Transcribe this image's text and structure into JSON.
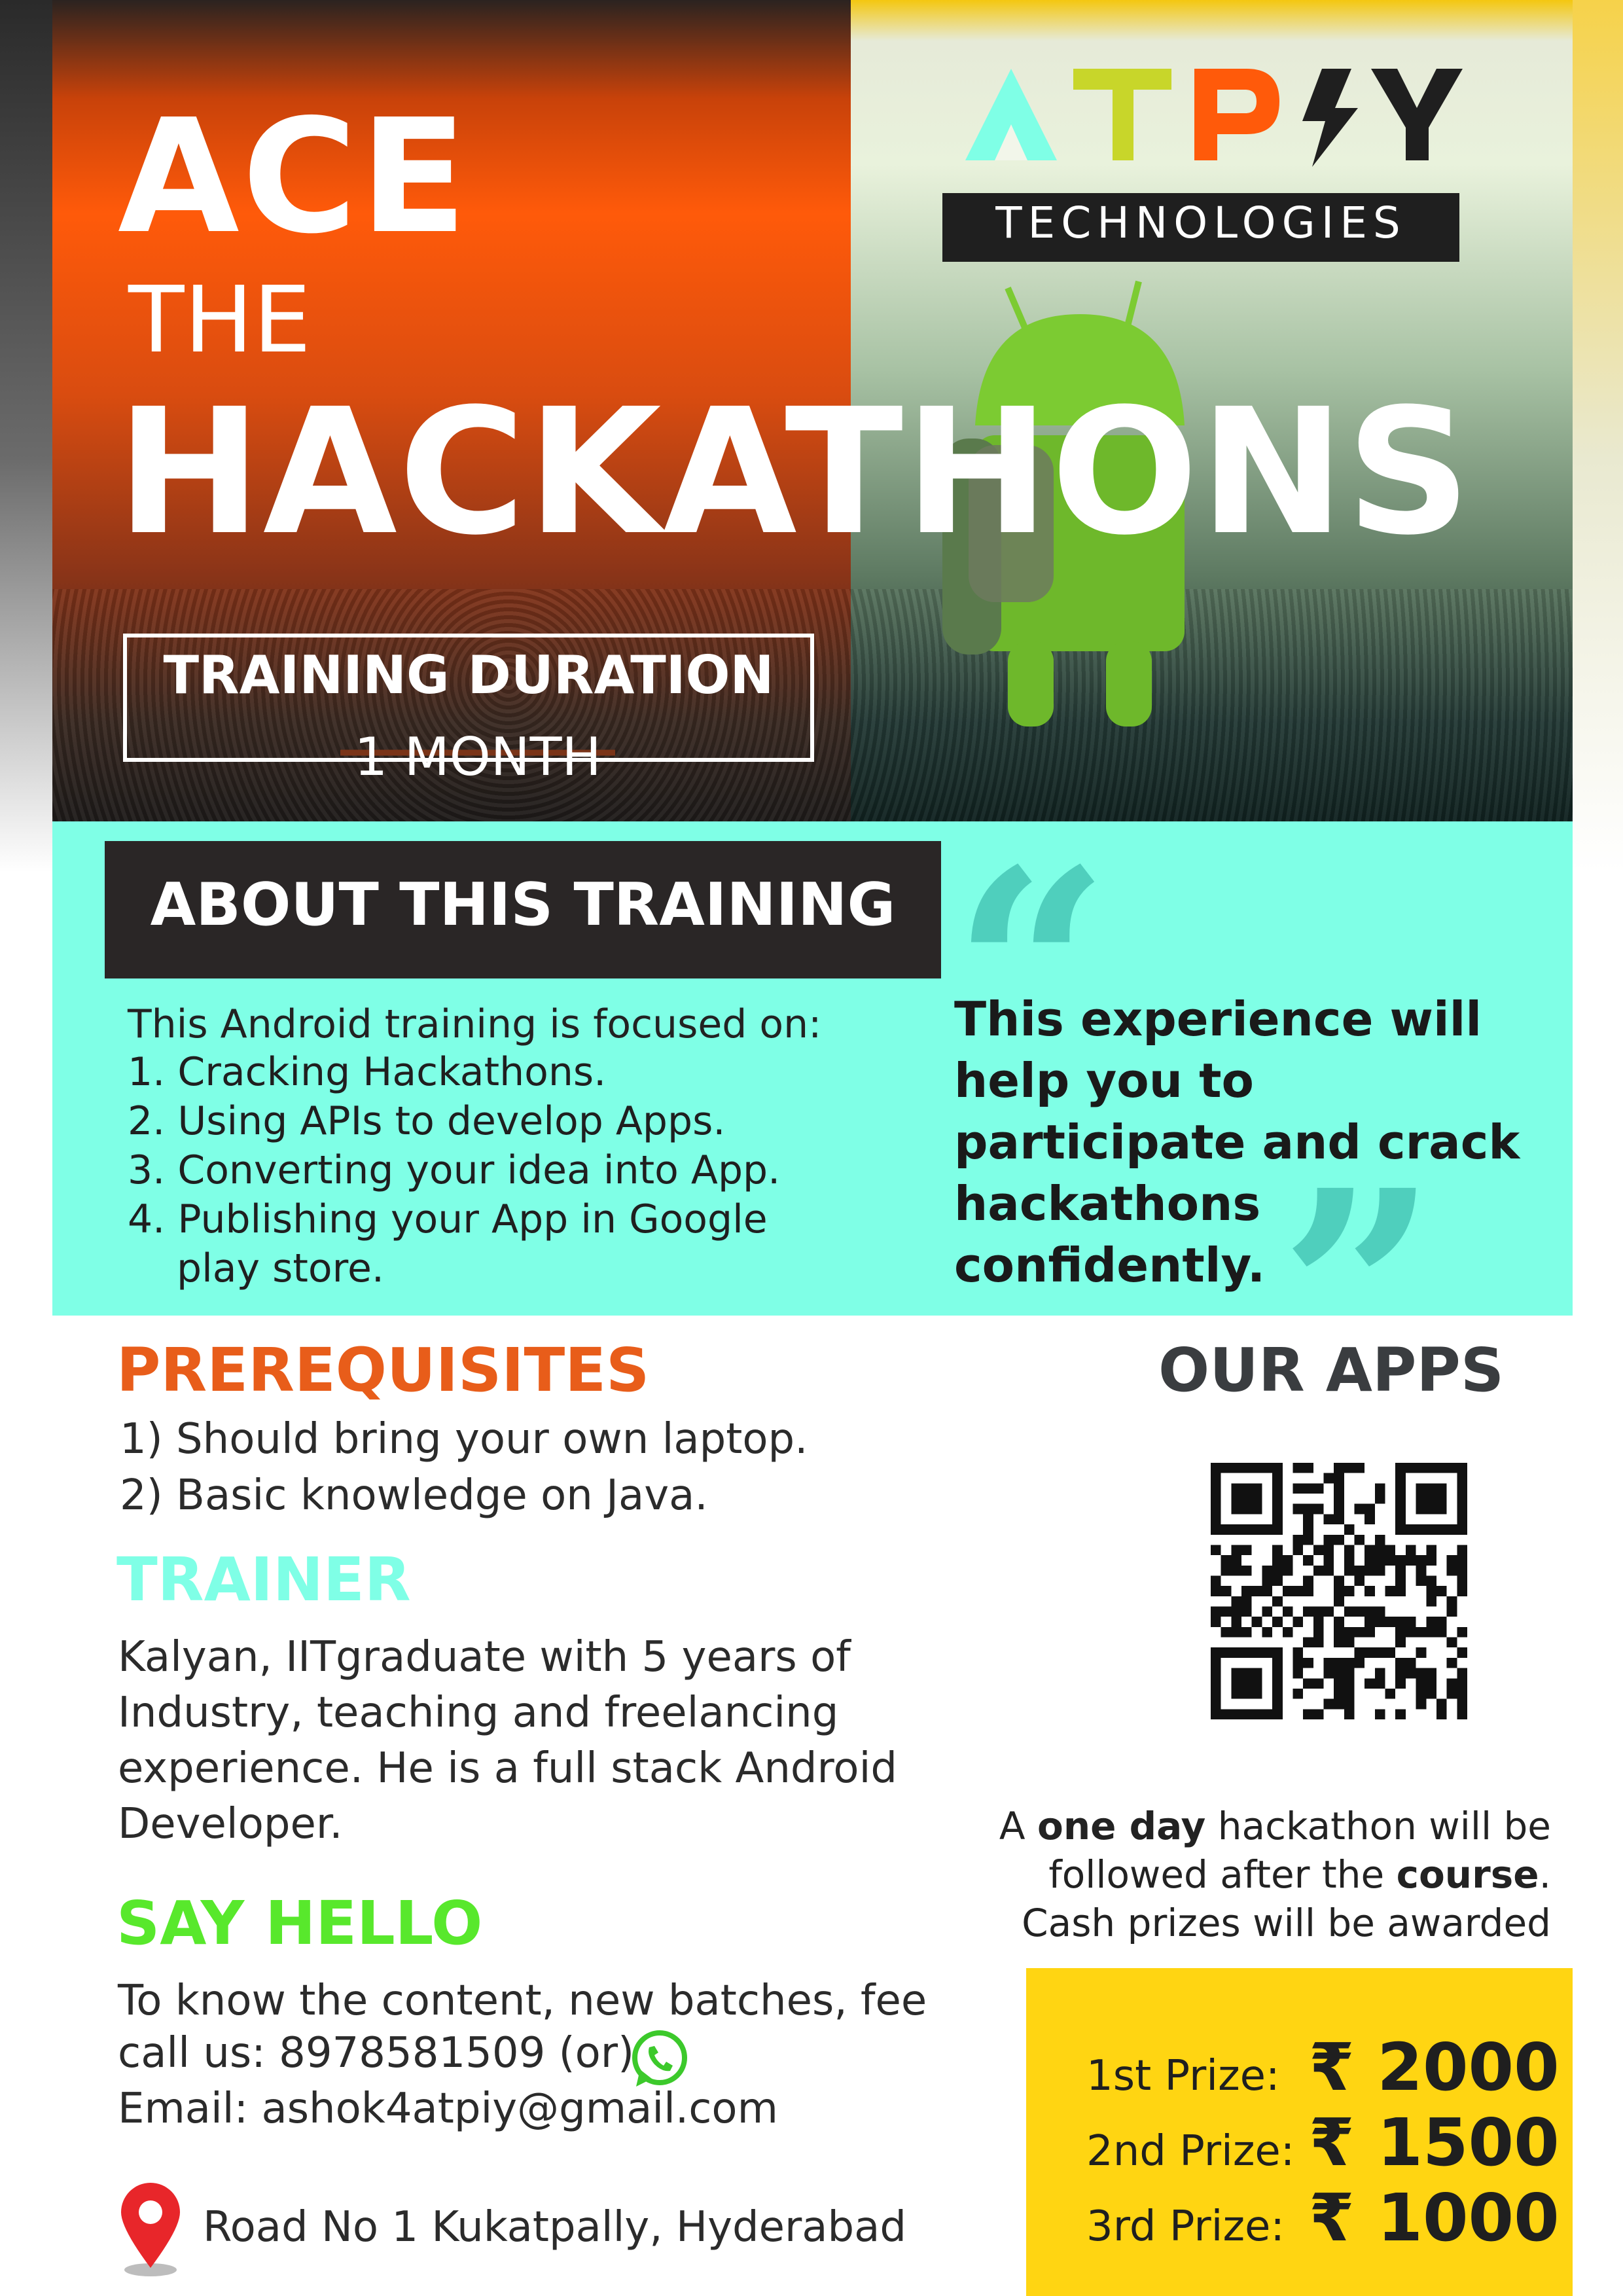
{
  "hero": {
    "title_line1": "ACE",
    "title_line2": "THE",
    "title_line3": "HACKATHONS",
    "duration_label": "TRAINING DURATION",
    "duration_value": "1 MONTH"
  },
  "logo": {
    "brand": "ATPIY",
    "sub": "TECHNOLOGIES",
    "colors": [
      "#7fffe6",
      "#c8d62a",
      "#ff5a0a",
      "#1f1f1f",
      "#1f1f1f"
    ]
  },
  "about": {
    "heading": "ABOUT THIS TRAINING",
    "intro": "This Android training is focused on:",
    "items": [
      "1. Cracking Hackathons.",
      "2. Using APIs to develop Apps.",
      "3. Converting your idea into App.",
      "4. Publishing your App in Google",
      "play store."
    ],
    "quote": "This experience will help you to participate and crack hackathons confidently."
  },
  "prerequisites": {
    "title": "PREREQUISITES",
    "items": [
      "1) Should bring your own laptop.",
      "2) Basic knowledge on Java."
    ]
  },
  "trainer": {
    "title": "TRAINER",
    "text": "Kalyan, IITgraduate with 5 years of Industry, teaching and freelancing experience. He is a full stack Android Developer."
  },
  "hello": {
    "title": "SAY HELLO",
    "line1": "To know the content, new batches, fee",
    "phone": "call us: 8978581509 (or)",
    "email": "Email: ashok4atpiy@gmail.com",
    "address": "Road No 1 Kukatpally, Hyderabad",
    "icons": [
      "whatsapp-icon",
      "location-pin-icon"
    ]
  },
  "apps": {
    "title": "OUR APPS",
    "note_line1_a": "A ",
    "note_line1_b": "one day",
    "note_line1_c": " hackathon will be",
    "note_line2_a": "followed after the ",
    "note_line2_b": "course",
    "note_line2_c": ".",
    "note_line3": "Cash prizes will be awarded"
  },
  "prizes": [
    {
      "label": "1st Prize:",
      "amount": "₹ 2000"
    },
    {
      "label": "2nd Prize:",
      "amount": "₹ 1500"
    },
    {
      "label": "3rd Prize:",
      "amount": "₹ 1000"
    }
  ],
  "colors": {
    "orange": "#ff5a0a",
    "mint": "#7fffe6",
    "yellow": "#ffd512",
    "green": "#58e82c",
    "dark": "#2a2626"
  }
}
